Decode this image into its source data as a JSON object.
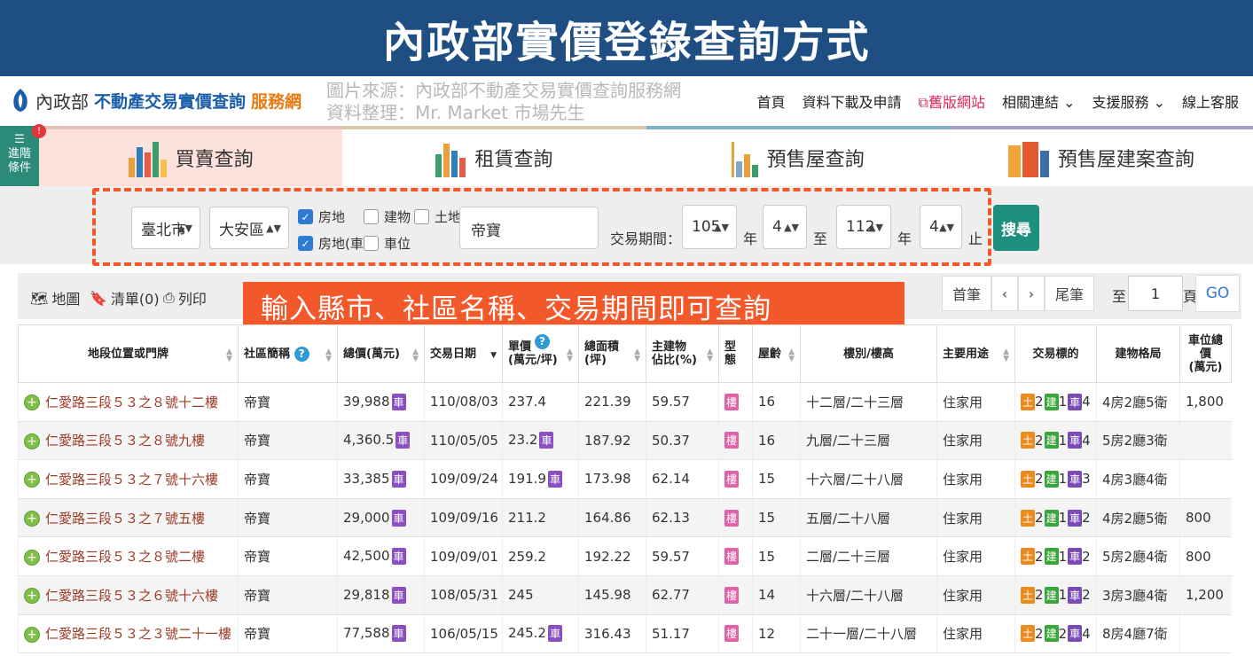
{
  "banner": {
    "title": "內政部實價登錄查詢方式"
  },
  "header": {
    "logo_gov": "內政部",
    "logo_main": "不動產交易實價查詢",
    "logo_sub": "服務網",
    "source_line1": "圖片來源：內政部不動產交易實價查詢服務網",
    "source_line2": "資料整理：Mr. Market 市場先生",
    "nav": [
      "首頁",
      "資料下載及申請",
      "舊版網站",
      "相關連結",
      "支援服務",
      "線上客服"
    ]
  },
  "tabs": {
    "advanced": "進階條件",
    "advanced_badge": "!",
    "items": [
      "買賣查詢",
      "租賃查詢",
      "預售屋查詢",
      "預售屋建案查詢"
    ]
  },
  "filters": {
    "city": "臺北市",
    "district": "大安區",
    "checkbox_house_land": "房地",
    "checkbox_building": "建物",
    "checkbox_land": "土地",
    "checkbox_house_land_car": "房地(車)",
    "checkbox_parking": "車位",
    "keyword": "帝寶",
    "period_label": "交易期間：",
    "from_year": "105",
    "year_unit": "年",
    "from_month": "4",
    "to_label": "至",
    "to_year": "112",
    "to_month": "4",
    "end_label": "止",
    "search_button": "搜尋"
  },
  "toolbar": {
    "map": "地圖",
    "list": "清單(0)",
    "print": "列印",
    "overlay_note": "輸入縣市、社區名稱、交易期間即可查詢",
    "first": "首筆",
    "prev": "‹",
    "next": "›",
    "last": "尾筆",
    "goto_prefix": "至",
    "page_value": "1",
    "page_unit": "頁",
    "go": "GO"
  },
  "table": {
    "headers": [
      "地段位置或門牌",
      "社區簡稱",
      "總價(萬元)",
      "交易日期",
      "單價\n(萬元/坪)",
      "總面積\n(坪)",
      "主建物\n佔比(%)",
      "型態",
      "屋齡",
      "樓別/樓高",
      "主要用途",
      "交易標的",
      "建物格局",
      "車位總價\n(萬元)"
    ],
    "car_tag": "車",
    "type_tag": "樓",
    "tag_land": "土",
    "tag_build": "建",
    "tag_car": "車",
    "rows": [
      {
        "addr": "仁愛路三段５３之８號十二樓",
        "community": "帝寶",
        "total": "39,988",
        "total_car": true,
        "date": "110/08/03",
        "unit": "237.4",
        "unit_car": false,
        "area": "221.39",
        "ratio": "59.57",
        "age": "16",
        "floor": "十二層/二十三層",
        "use": "住家用",
        "land": "2",
        "build": "1",
        "car": "4",
        "layout": "4房2廳5衛",
        "parking": "1,800"
      },
      {
        "addr": "仁愛路三段５３之８號九樓",
        "community": "帝寶",
        "total": "4,360.5",
        "total_car": true,
        "date": "110/05/05",
        "unit": "23.2",
        "unit_car": true,
        "area": "187.92",
        "ratio": "50.37",
        "age": "16",
        "floor": "九層/二十三層",
        "use": "住家用",
        "land": "2",
        "build": "1",
        "car": "4",
        "layout": "5房2廳3衛",
        "parking": ""
      },
      {
        "addr": "仁愛路三段５３之７號十六樓",
        "community": "帝寶",
        "total": "33,385",
        "total_car": true,
        "date": "109/09/24",
        "unit": "191.9",
        "unit_car": true,
        "area": "173.98",
        "ratio": "62.14",
        "age": "15",
        "floor": "十六層/二十八層",
        "use": "住家用",
        "land": "2",
        "build": "1",
        "car": "3",
        "layout": "4房3廳4衛",
        "parking": ""
      },
      {
        "addr": "仁愛路三段５３之７號五樓",
        "community": "帝寶",
        "total": "29,000",
        "total_car": true,
        "date": "109/09/16",
        "unit": "211.2",
        "unit_car": false,
        "area": "164.86",
        "ratio": "62.13",
        "age": "15",
        "floor": "五層/二十八層",
        "use": "住家用",
        "land": "2",
        "build": "1",
        "car": "2",
        "layout": "4房2廳5衛",
        "parking": "800"
      },
      {
        "addr": "仁愛路三段５３之８號二樓",
        "community": "帝寶",
        "total": "42,500",
        "total_car": true,
        "date": "109/09/01",
        "unit": "259.2",
        "unit_car": false,
        "area": "192.22",
        "ratio": "59.57",
        "age": "15",
        "floor": "二層/二十三層",
        "use": "住家用",
        "land": "2",
        "build": "1",
        "car": "2",
        "layout": "5房2廳4衛",
        "parking": "800"
      },
      {
        "addr": "仁愛路三段５３之６號十六樓",
        "community": "帝寶",
        "total": "29,818",
        "total_car": true,
        "date": "108/05/31",
        "unit": "245",
        "unit_car": false,
        "area": "145.98",
        "ratio": "62.77",
        "age": "14",
        "floor": "十六層/二十八層",
        "use": "住家用",
        "land": "2",
        "build": "1",
        "car": "2",
        "layout": "3房3廳4衛",
        "parking": "1,200"
      },
      {
        "addr": "仁愛路三段５３之３號二十一樓",
        "community": "帝寶",
        "total": "77,588",
        "total_car": true,
        "date": "106/05/15",
        "unit": "245.2",
        "unit_car": true,
        "area": "316.43",
        "ratio": "51.17",
        "age": "12",
        "floor": "二十一層/二十八層",
        "use": "住家用",
        "land": "2",
        "build": "2",
        "car": "4",
        "layout": "8房4廳7衛",
        "parking": ""
      }
    ]
  }
}
